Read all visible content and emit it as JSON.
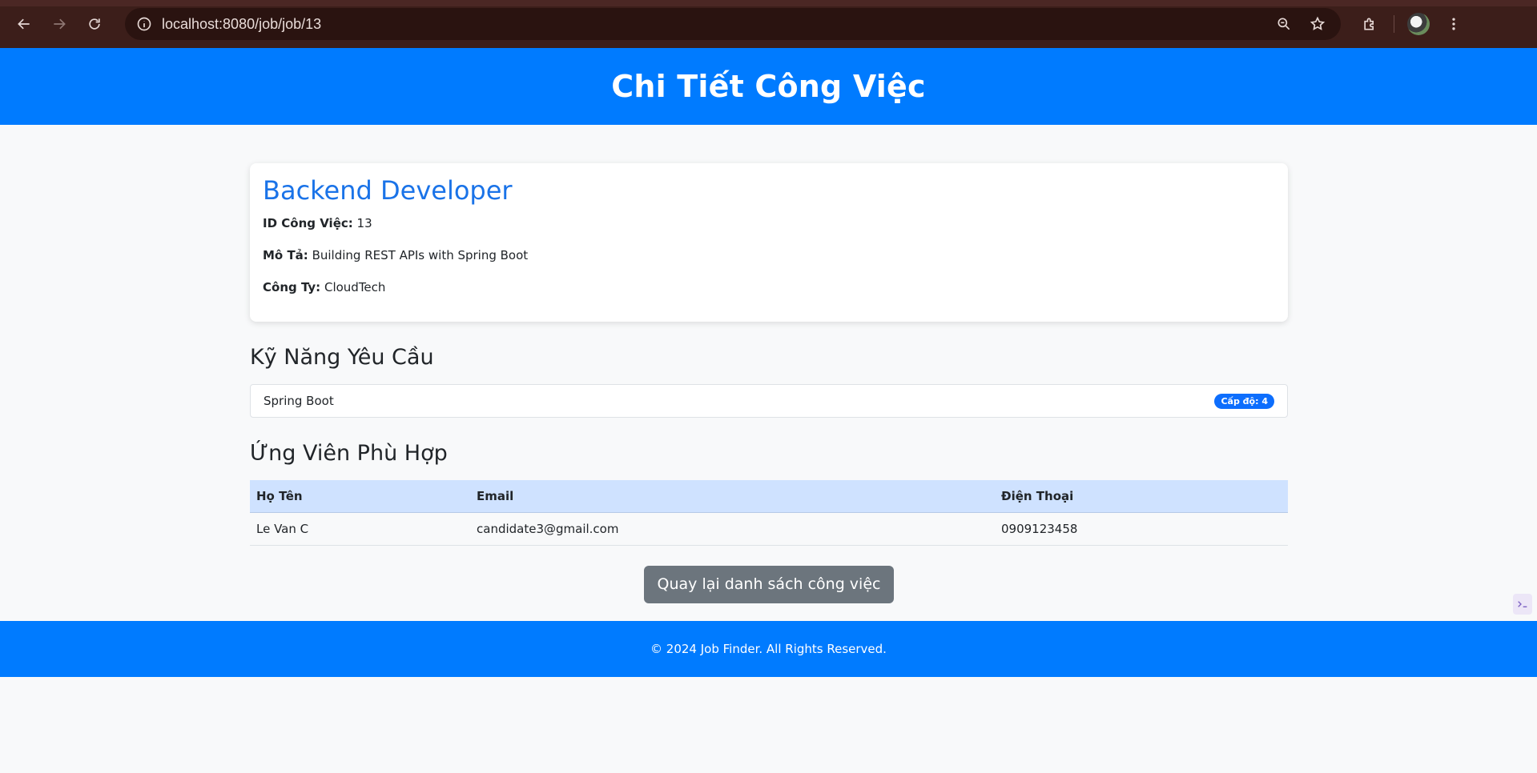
{
  "browser": {
    "url": "localhost:8080/job/job/13"
  },
  "header": {
    "title": "Chi Tiết Công Việc"
  },
  "job": {
    "title": "Backend Developer",
    "id_label": "ID Công Việc:",
    "id_value": "13",
    "desc_label": "Mô Tả:",
    "desc_value": "Building REST APIs with Spring Boot",
    "company_label": "Công Ty:",
    "company_value": "CloudTech"
  },
  "skills": {
    "title": "Kỹ Năng Yêu Cầu",
    "items": [
      {
        "name": "Spring Boot",
        "badge": "Cấp độ: 4"
      }
    ]
  },
  "candidates": {
    "title": "Ứng Viên Phù Hợp",
    "columns": [
      "Họ Tên",
      "Email",
      "Điện Thoại"
    ],
    "rows": [
      [
        "Le Van C",
        "candidate3@gmail.com",
        "0909123458"
      ]
    ]
  },
  "actions": {
    "back_label": "Quay lại danh sách công việc"
  },
  "footer": {
    "text": "© 2024 Job Finder. All Rights Reserved."
  },
  "colors": {
    "primary": "#007bff",
    "title_blue": "#1a73e8",
    "badge": "#0d6efd",
    "secondary_button": "#6c757d",
    "table_header": "#cfe2ff"
  }
}
